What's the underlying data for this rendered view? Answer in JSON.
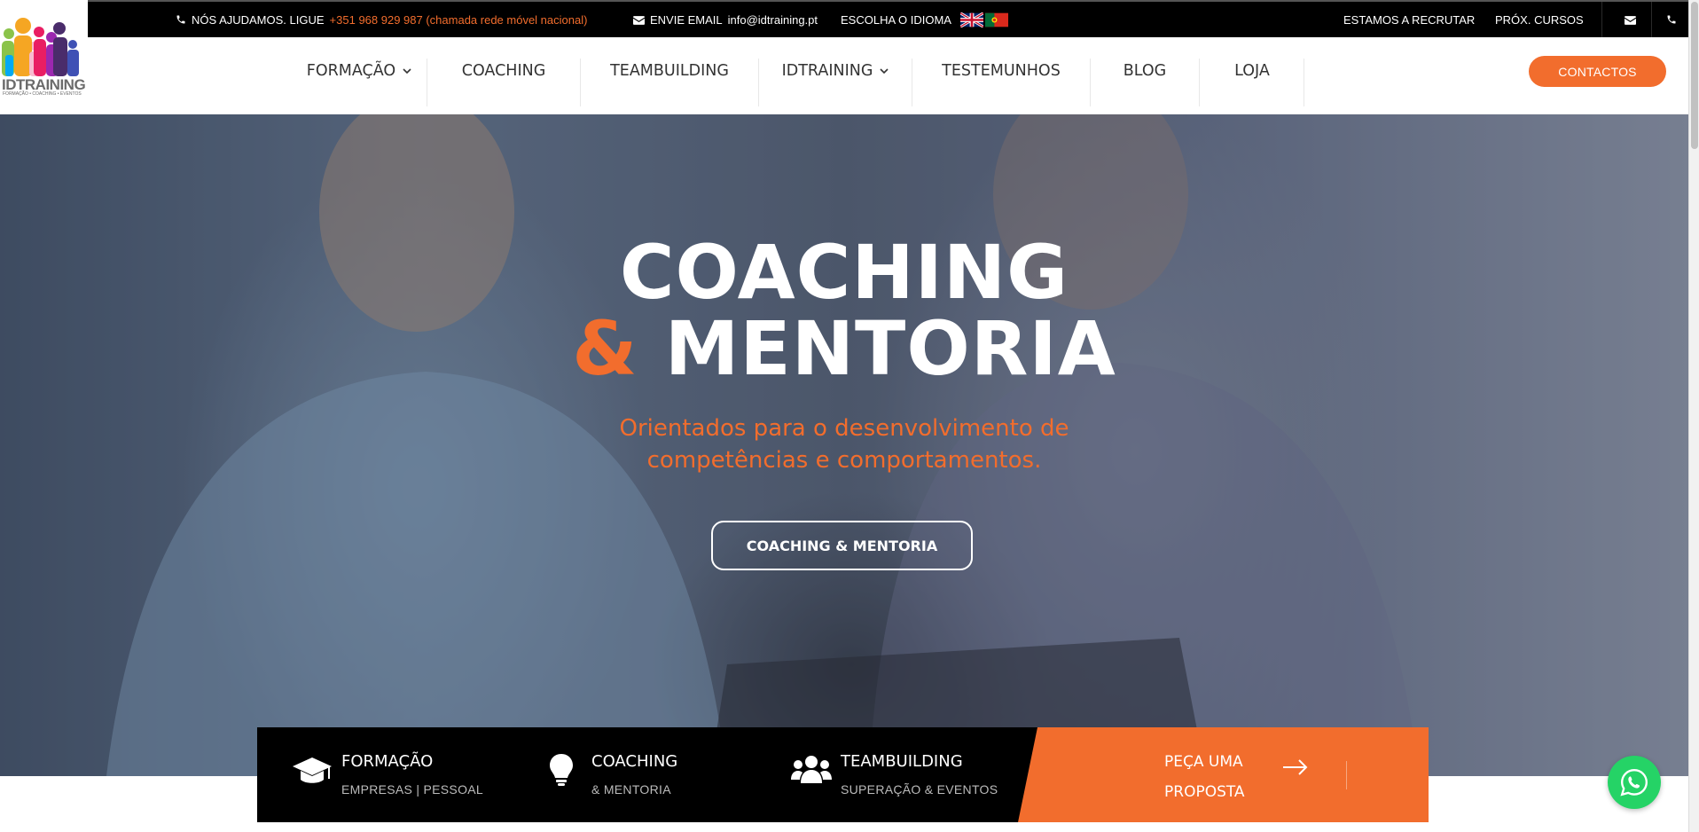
{
  "topbar": {
    "help_label": "NÓS AJUDAMOS. LIGUE",
    "phone": "+351 968 929 987 (chamada rede móvel nacional)",
    "email_label": "ENVIE EMAIL",
    "email": "info@idtraining.pt",
    "language_label": "ESCOLHA O IDIOMA",
    "recruit": "ESTAMOS A RECRUTAR",
    "next_courses": "PRÓX. CURSOS"
  },
  "logo": {
    "name": "IDTRAINING",
    "tagline": "FORMAÇÃO • COACHING • EVENTOS"
  },
  "nav": {
    "items": [
      "FORMAÇÃO",
      "COACHING",
      "TEAMBUILDING",
      "IDTRAINING",
      "TESTEMUNHOS",
      "BLOG",
      "LOJA"
    ],
    "contact": "CONTACTOS"
  },
  "hero": {
    "title_line1": "COACHING",
    "title_amp": "&",
    "title_line2": "MENTORIA",
    "subtitle_line1": "Orientados para o desenvolvimento de",
    "subtitle_line2": "competências e comportamentos.",
    "button": "COACHING & MENTORIA"
  },
  "strip": {
    "items": [
      {
        "title": "FORMAÇÃO",
        "subtitle": "EMPRESAS | PESSOAL",
        "icon": "graduation-cap-icon"
      },
      {
        "title": "COACHING",
        "subtitle": "& MENTORIA",
        "icon": "lightbulb-icon"
      },
      {
        "title": "TEAMBUILDING",
        "subtitle": "SUPERAÇÃO & EVENTOS",
        "icon": "users-icon"
      }
    ],
    "proposal_line1": "PEÇA UMA",
    "proposal_line2": "PROPOSTA"
  },
  "colors": {
    "accent": "#f26d2d",
    "topbar": "#000000",
    "whatsapp": "#25d366"
  }
}
